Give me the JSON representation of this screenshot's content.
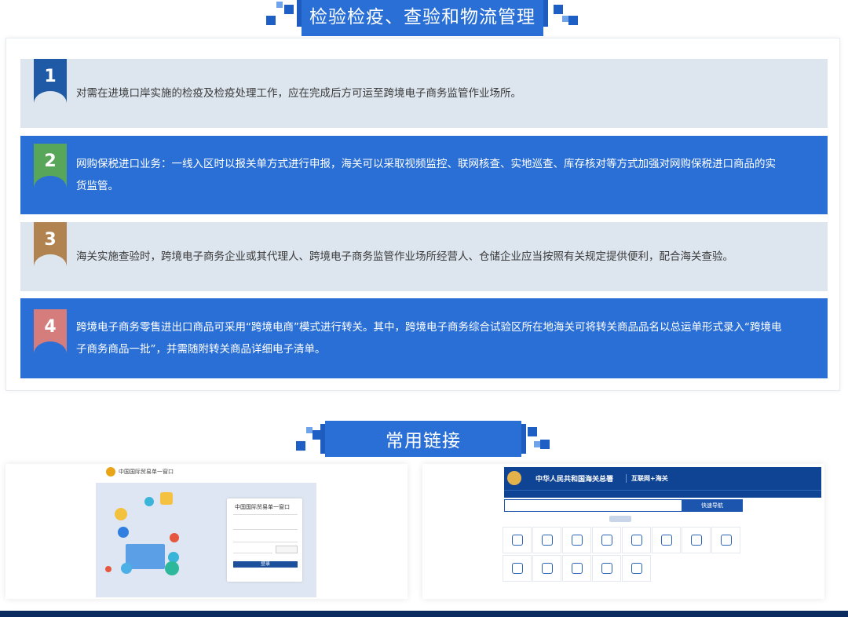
{
  "section1": {
    "title": "检验检疫、查验和物流管理",
    "items": [
      {
        "num": "1",
        "text": "对需在进境口岸实施的检疫及检疫处理工作，应在完成后方可运至跨境电子商务监管作业场所。"
      },
      {
        "num": "2",
        "text": "网购保税进口业务：一线入区时以报关单方式进行申报，海关可以采取视频监控、联网核查、实地巡查、库存核对等方式加强对网购保税进口商品的实货监管。"
      },
      {
        "num": "3",
        "text": "海关实施查验时，跨境电子商务企业或其代理人、跨境电子商务监管作业场所经营人、仓储企业应当按照有关规定提供便利，配合海关查验。"
      },
      {
        "num": "4",
        "text": "跨境电子商务零售进出口商品可采用“跨境电商”模式进行转关。其中，跨境电子商务综合试验区所在地海关可将转关商品品名以总运单形式录入“跨境电子商务商品一批”，并需随附转关商品详细电子清单。"
      }
    ]
  },
  "section2": {
    "title": "常用链接",
    "links": [
      {
        "name": "中国国际贸易单一窗口",
        "login_title": "中国国际贸易单一窗口",
        "login_button": "登录"
      },
      {
        "name": "中华人民共和国海关总署",
        "tagline": "互联网+海关",
        "search_button": "快速导航"
      }
    ]
  },
  "colors": {
    "accent": "#2a6fd6",
    "light_panel": "#dde5ef",
    "footer": "#0b2b60"
  }
}
